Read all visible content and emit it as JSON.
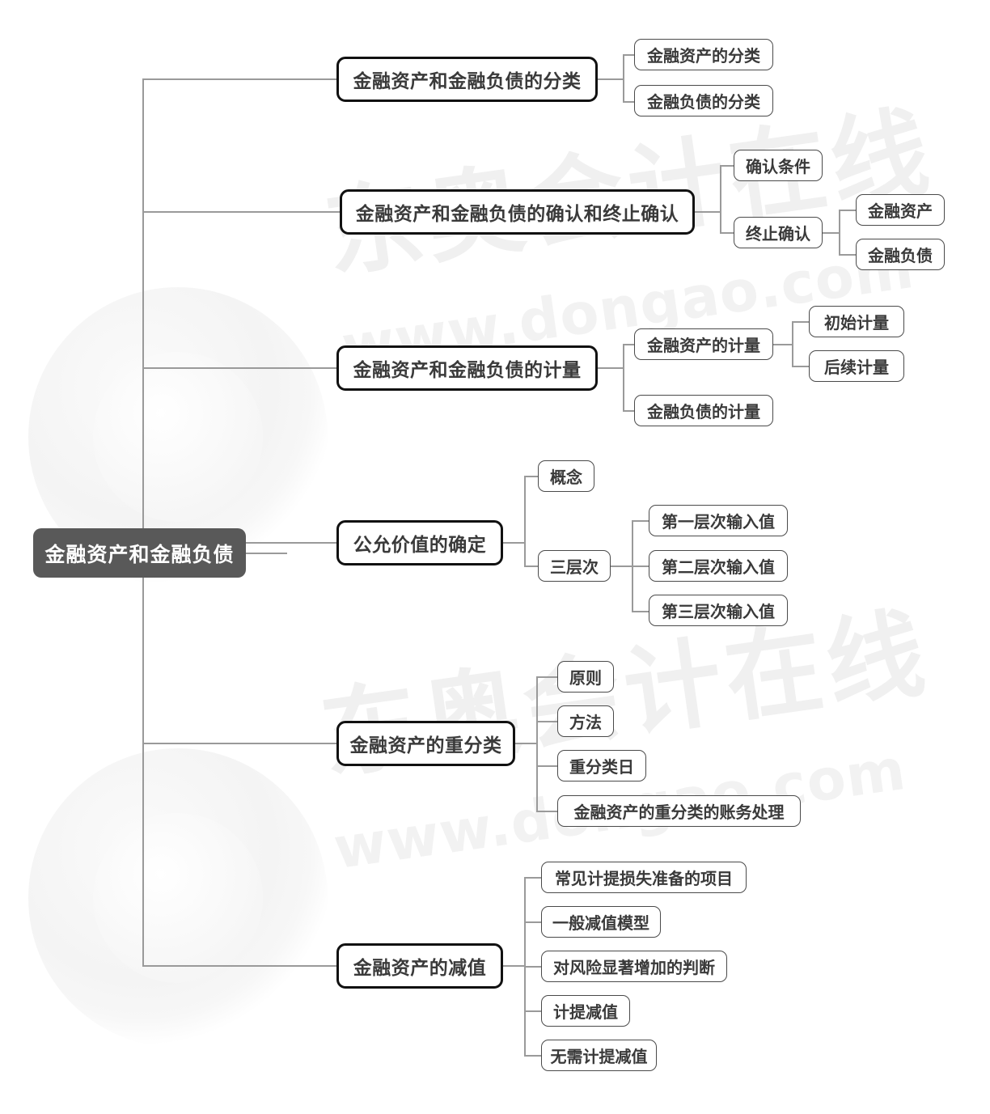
{
  "watermark": {
    "brand_cn": "东奥会计在线",
    "url": "www.dongao.com",
    "color": "#f0f0f0"
  },
  "colors": {
    "root_fill": "#595959",
    "root_text": "#ffffff",
    "level1_border": "#111111",
    "level2_border": "#4a4a4a",
    "connector": "#9a9a9a",
    "node_text": "#3a3a3a",
    "background": "#ffffff"
  },
  "mindmap": {
    "type": "mindmap",
    "root": "金融资产和金融负债",
    "branches": [
      {
        "label": "金融资产和金融负债的分类",
        "children": [
          {
            "label": "金融资产的分类",
            "children": []
          },
          {
            "label": "金融负债的分类",
            "children": []
          }
        ]
      },
      {
        "label": "金融资产和金融负债的确认和终止确认",
        "children": [
          {
            "label": "确认条件",
            "children": []
          },
          {
            "label": "终止确认",
            "children": [
              {
                "label": "金融资产"
              },
              {
                "label": "金融负债"
              }
            ]
          }
        ]
      },
      {
        "label": "金融资产和金融负债的计量",
        "children": [
          {
            "label": "金融资产的计量",
            "children": [
              {
                "label": "初始计量"
              },
              {
                "label": "后续计量"
              }
            ]
          },
          {
            "label": "金融负债的计量",
            "children": []
          }
        ]
      },
      {
        "label": "公允价值的确定",
        "children": [
          {
            "label": "概念",
            "children": []
          },
          {
            "label": "三层次",
            "children": [
              {
                "label": "第一层次输入值"
              },
              {
                "label": "第二层次输入值"
              },
              {
                "label": "第三层次输入值"
              }
            ]
          }
        ]
      },
      {
        "label": "金融资产的重分类",
        "children": [
          {
            "label": "原则",
            "children": []
          },
          {
            "label": "方法",
            "children": []
          },
          {
            "label": "重分类日",
            "children": []
          },
          {
            "label": "金融资产的重分类的账务处理",
            "children": []
          }
        ]
      },
      {
        "label": "金融资产的减值",
        "children": [
          {
            "label": "常见计提损失准备的项目",
            "children": []
          },
          {
            "label": "一般减值模型",
            "children": []
          },
          {
            "label": "对风险显著增加的判断",
            "children": []
          },
          {
            "label": "计提减值",
            "children": []
          },
          {
            "label": "无需计提减值",
            "children": []
          }
        ]
      }
    ]
  }
}
